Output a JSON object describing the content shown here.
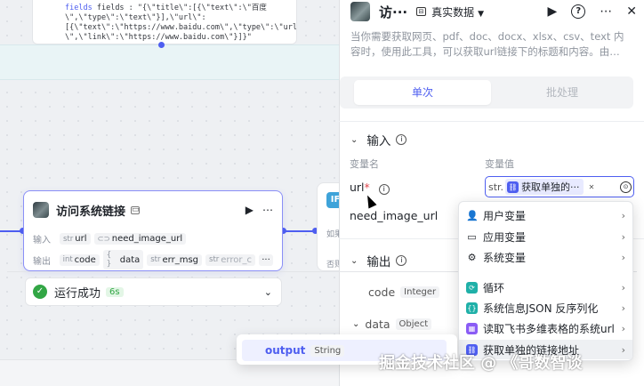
{
  "canvas": {
    "code_snippet": [
      "fields : \"{\\\"title\\\":[{\\\"text\\\":\\\"百度",
      "\\\",\\\"type\\\":\\\"text\\\"}],\\\"url\\\":",
      "[{\\\"text\\\":\\\"https://www.baidu.com\\\",\\\"type\\\":\\\"url",
      "\\\",\\\"link\\\":\\\"https://www.baidu.com\\\"}]}\""
    ],
    "node": {
      "title": "访问系统链接",
      "input_label": "输入",
      "output_label": "输出",
      "inputs": [
        {
          "type": "str",
          "name": "url"
        },
        {
          "type": "toggle",
          "name": "need_image_url"
        }
      ],
      "outputs": [
        {
          "type": "int",
          "name": "code"
        },
        {
          "type": "{ }",
          "name": "data"
        },
        {
          "type": "str",
          "name": "err_msg"
        },
        {
          "type": "str",
          "name": "error_c"
        }
      ],
      "more_label": "···"
    },
    "status": {
      "text": "运行成功",
      "duration": "6s"
    },
    "next_node": {
      "badge": "IF",
      "line_a": "如果",
      "line_b": "否则"
    }
  },
  "panel": {
    "title": "访···",
    "data_mode": "真实数据",
    "description": "当你需要获取网页、pdf、doc、docx、xlsx、csv、text 内容时，使用此工具，可以获取url链接下的标题和内容。由…",
    "tabs": [
      "单次",
      "批处理"
    ],
    "input_section": {
      "title": "输入",
      "col_name": "变量名",
      "col_value": "变量值",
      "vars": [
        {
          "name": "url",
          "required": true,
          "type": "str.",
          "value": "获取单独的···"
        },
        {
          "name": "need_image_url",
          "required": false
        }
      ]
    },
    "output_section": {
      "title": "输出",
      "fields": [
        {
          "name": "code",
          "type": "Integer"
        },
        {
          "name": "data",
          "type": "Object"
        }
      ]
    }
  },
  "menu": {
    "items": [
      {
        "icon": "user-icon",
        "label": "用户变量"
      },
      {
        "icon": "folder-icon",
        "label": "应用变量"
      },
      {
        "icon": "gear-icon",
        "label": "系统变量"
      },
      {
        "icon": "loop-icon",
        "label": "循环",
        "color": "#1fb0a8"
      },
      {
        "icon": "json-icon",
        "label": "系统信息JSON 反序列化",
        "color": "#1fb0a8"
      },
      {
        "icon": "table-icon",
        "label": "读取飞书多维表格的系统url",
        "color": "#8a5cf5"
      },
      {
        "icon": "link-icon",
        "label": "获取单独的链接地址",
        "color": "#4e5ef0"
      }
    ]
  },
  "tooltip": {
    "name": "output",
    "type": "String"
  },
  "watermark": "掘金技术社区 @ 《哥数智谈"
}
